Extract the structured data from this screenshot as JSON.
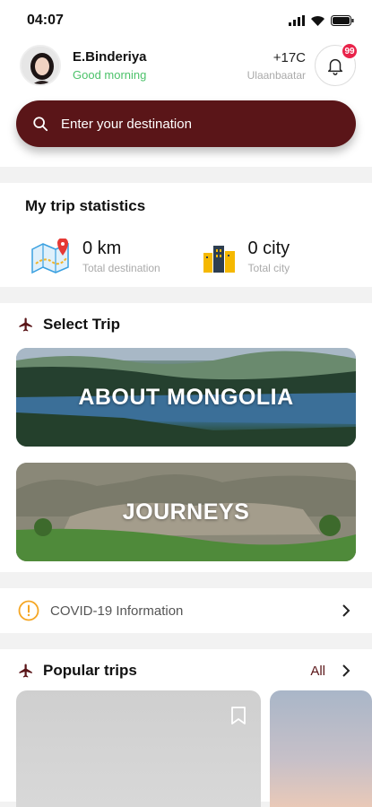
{
  "status": {
    "time": "04:07"
  },
  "user": {
    "name": "E.Binderiya",
    "greeting": "Good morning"
  },
  "weather": {
    "temp": "+17C",
    "city": "Ulaanbaatar"
  },
  "notifications": {
    "count": "99"
  },
  "search": {
    "placeholder": "Enter your destination"
  },
  "stats": {
    "title": "My trip statistics",
    "items": [
      {
        "value": "0 km",
        "label": "Total destination"
      },
      {
        "value": "0 city",
        "label": "Total city"
      }
    ]
  },
  "select_trip": {
    "title": "Select Trip",
    "banners": [
      {
        "label": "ABOUT MONGOLIA"
      },
      {
        "label": "JOURNEYS"
      }
    ]
  },
  "covid": {
    "label": "COVID-19 Information"
  },
  "popular": {
    "title": "Popular trips",
    "all_label": "All"
  },
  "colors": {
    "brand": "#5a1518",
    "greeting": "#4cc26a",
    "badge": "#e9234a"
  }
}
